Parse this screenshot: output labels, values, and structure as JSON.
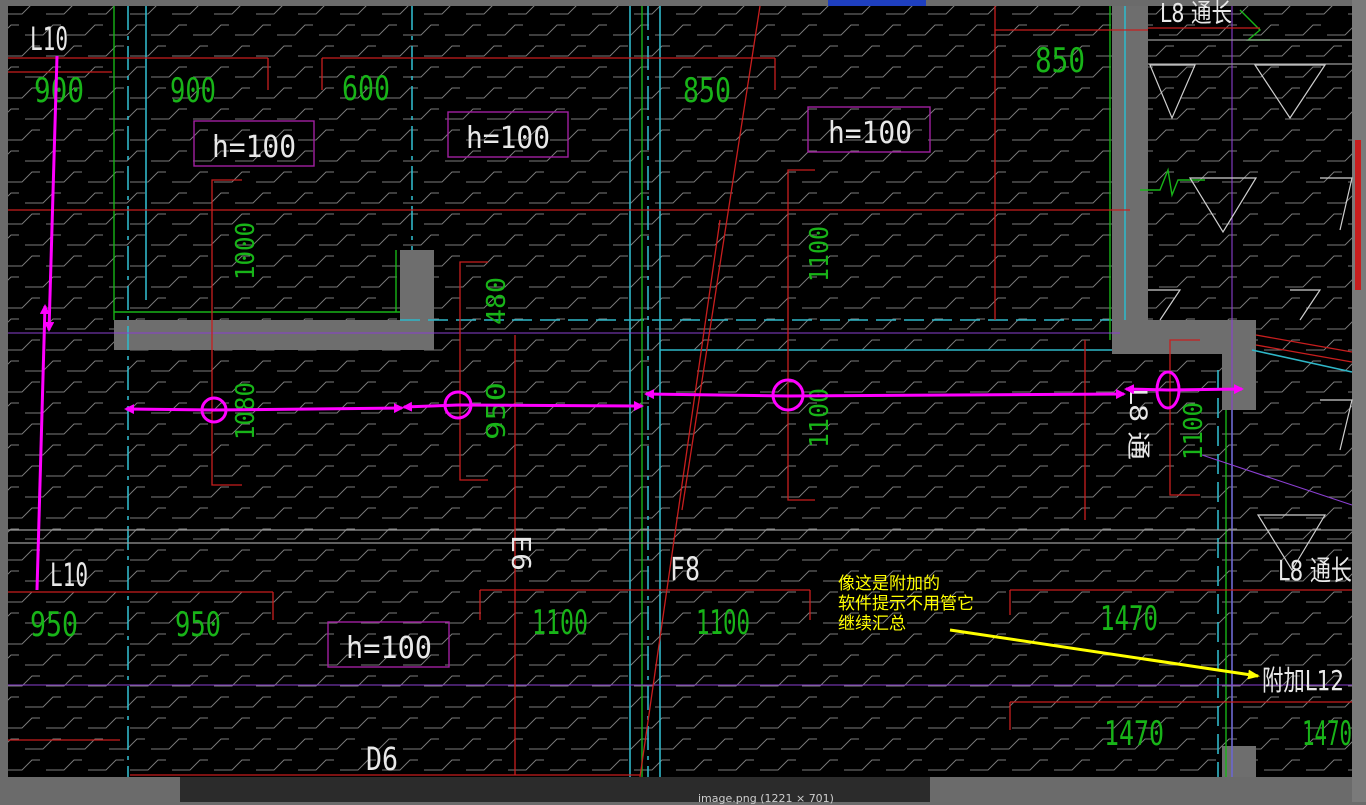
{
  "drawing": {
    "beam_labels": {
      "l10_top": "L10",
      "l10_bottom": "L10",
      "l8_top": "L8 通长",
      "l8_right_vertical": "L8 通",
      "l8_right": "L8 通长",
      "attached_l12": "附加L12",
      "e6": "E6",
      "f8": "F8",
      "d6": "D6"
    },
    "dimensions": {
      "d_900_a": "900",
      "d_900_b": "900",
      "d_600": "600",
      "d_850_a": "850",
      "d_850_b": "850",
      "d_1000": "1000",
      "d_480": "480",
      "d_1100_a": "1100",
      "d_1080": "1080",
      "d_950_v": "950",
      "d_1100_v": "1100",
      "d_1100_r": "1100",
      "d_950_a": "950",
      "d_950_b": "950",
      "d_1100_b": "1100",
      "d_1100_c": "1100",
      "d_1470_a": "1470",
      "d_1470_b": "1470",
      "d_1470_c": "1470"
    },
    "slab_thickness": {
      "h1": "h=100",
      "h2": "h=100",
      "h3": "h=100",
      "h4": "h=100"
    },
    "annotation": {
      "line1": "像这是附加的",
      "line2": "软件提示不用管它",
      "line3": "继续汇总"
    },
    "colors": {
      "background": "#000000",
      "beam_red": "#c81e1e",
      "cyan": "#2fb7c8",
      "green_dim": "#18b418",
      "magenta_markup": "#ff00ff",
      "yellow_note": "#ffff00",
      "wall_gray": "#6e6e6e",
      "purple_box": "#a020a0"
    }
  },
  "viewer": {
    "filename": "image.png (1221 × 701)"
  }
}
